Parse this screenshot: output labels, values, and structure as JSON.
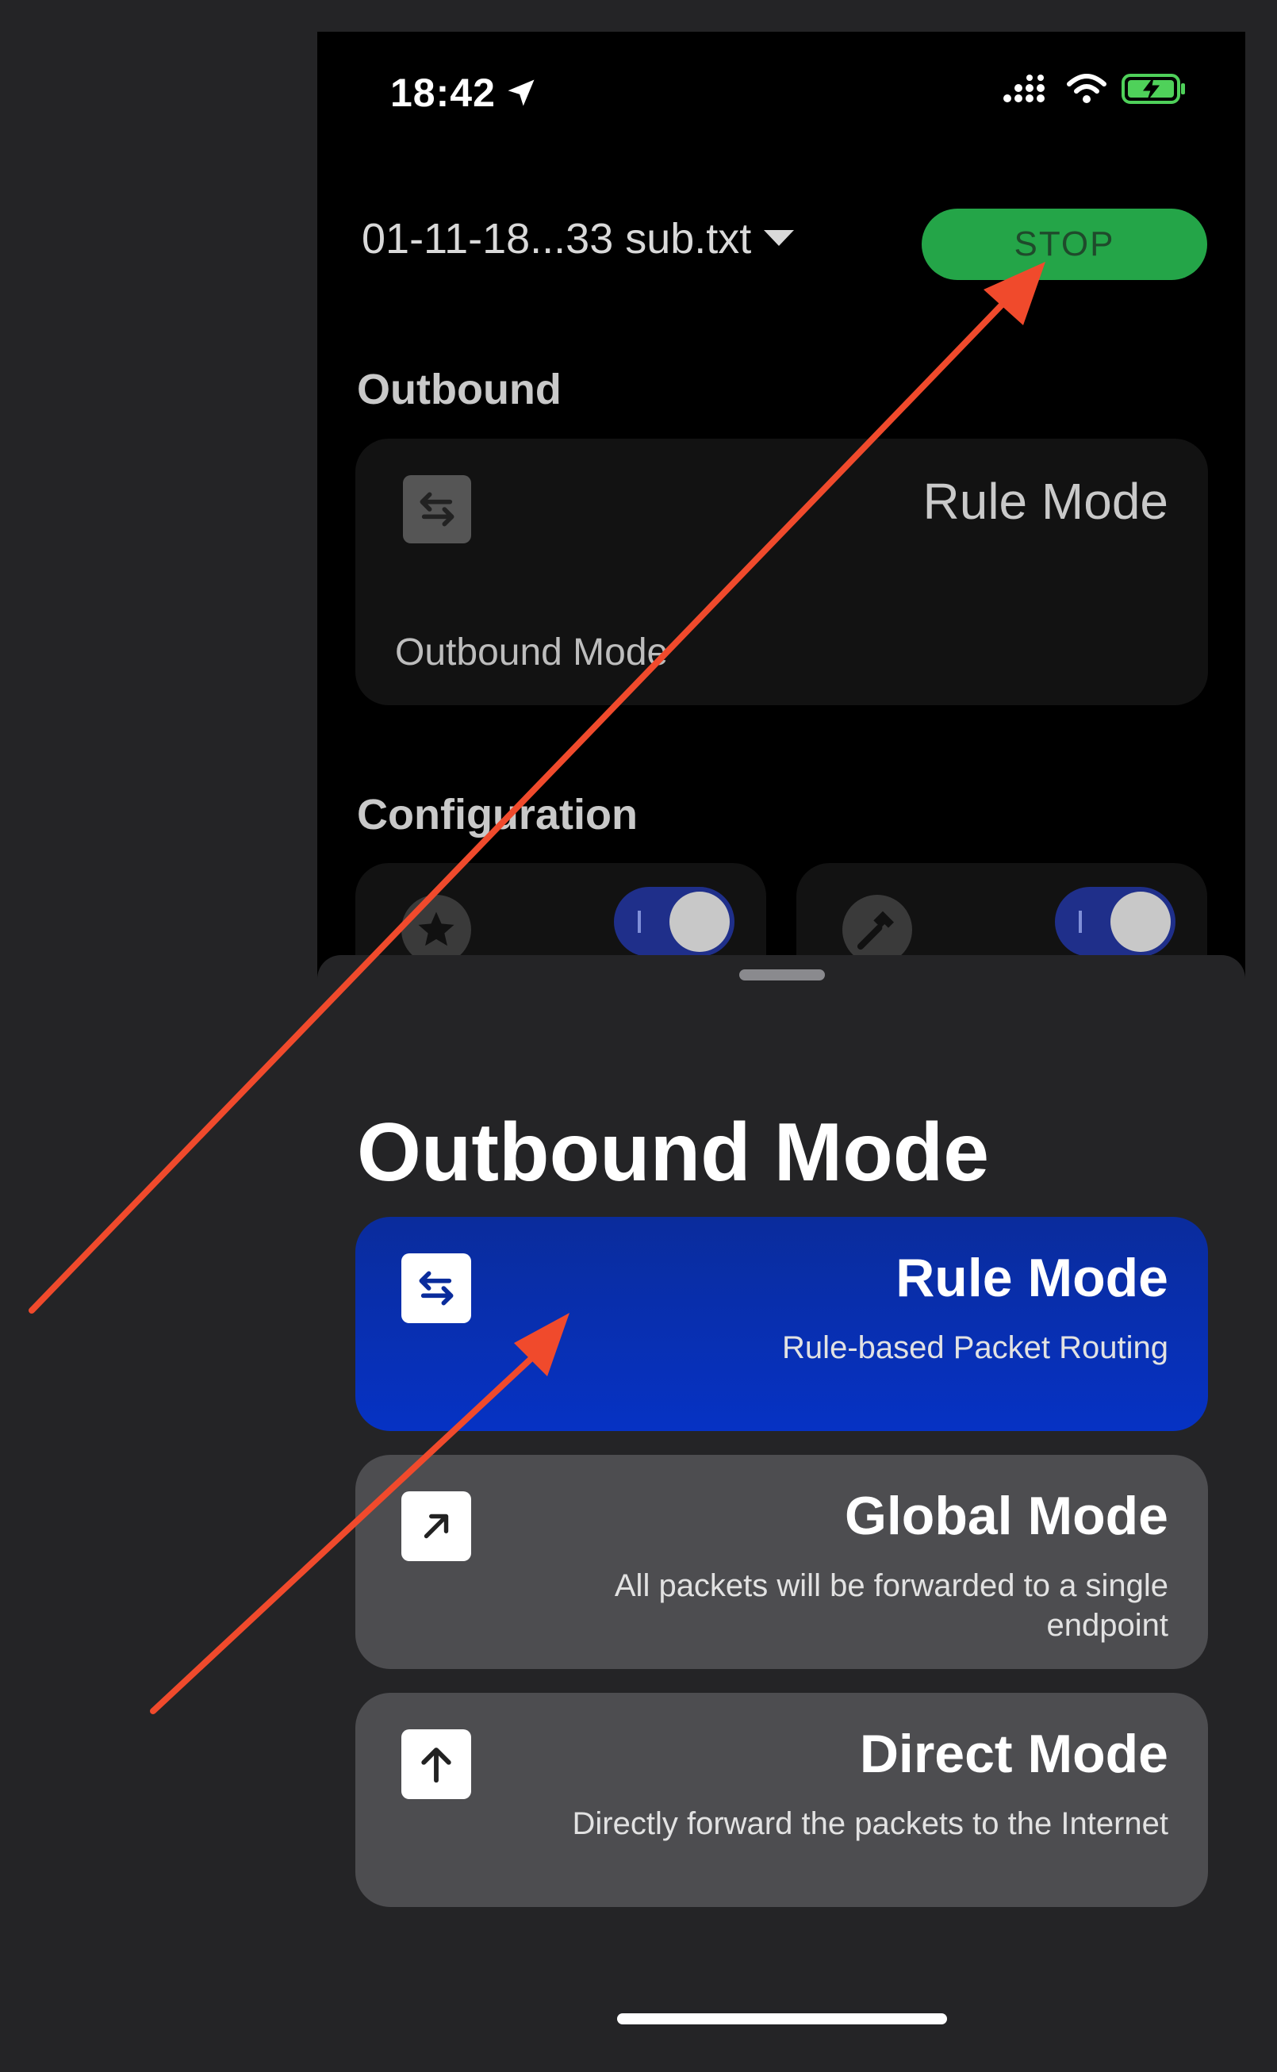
{
  "status_bar": {
    "time": "18:42",
    "location_icon": "location-arrow-icon",
    "signal_icon": "cellular-signal-icon",
    "wifi_icon": "wifi-icon",
    "battery_icon": "battery-charging-icon"
  },
  "header": {
    "profile_name": "01-11-18...33 sub.txt",
    "stop_label": "STOP"
  },
  "outbound_section": {
    "heading": "Outbound",
    "card_value": "Rule Mode",
    "card_label": "Outbound Mode"
  },
  "configuration_section": {
    "heading": "Configuration",
    "cards": [
      {
        "icon": "star-icon",
        "toggle_on": true
      },
      {
        "icon": "hammer-icon",
        "toggle_on": true
      }
    ]
  },
  "sheet": {
    "title": "Outbound Mode",
    "options": [
      {
        "title": "Rule Mode",
        "description": "Rule-based Packet Routing",
        "icon": "swap-arrows-icon",
        "selected": true
      },
      {
        "title": "Global Mode",
        "description": "All packets will be forwarded to a single endpoint",
        "icon": "arrow-up-right-icon",
        "selected": false
      },
      {
        "title": "Direct Mode",
        "description": "Directly forward the packets to the Internet",
        "icon": "arrow-up-icon",
        "selected": false
      }
    ]
  },
  "colors": {
    "stop_button": "#24a548",
    "selected_option": "#0632c4",
    "option_background": "#4d4d50",
    "annotation_arrow": "#f04a2c"
  }
}
